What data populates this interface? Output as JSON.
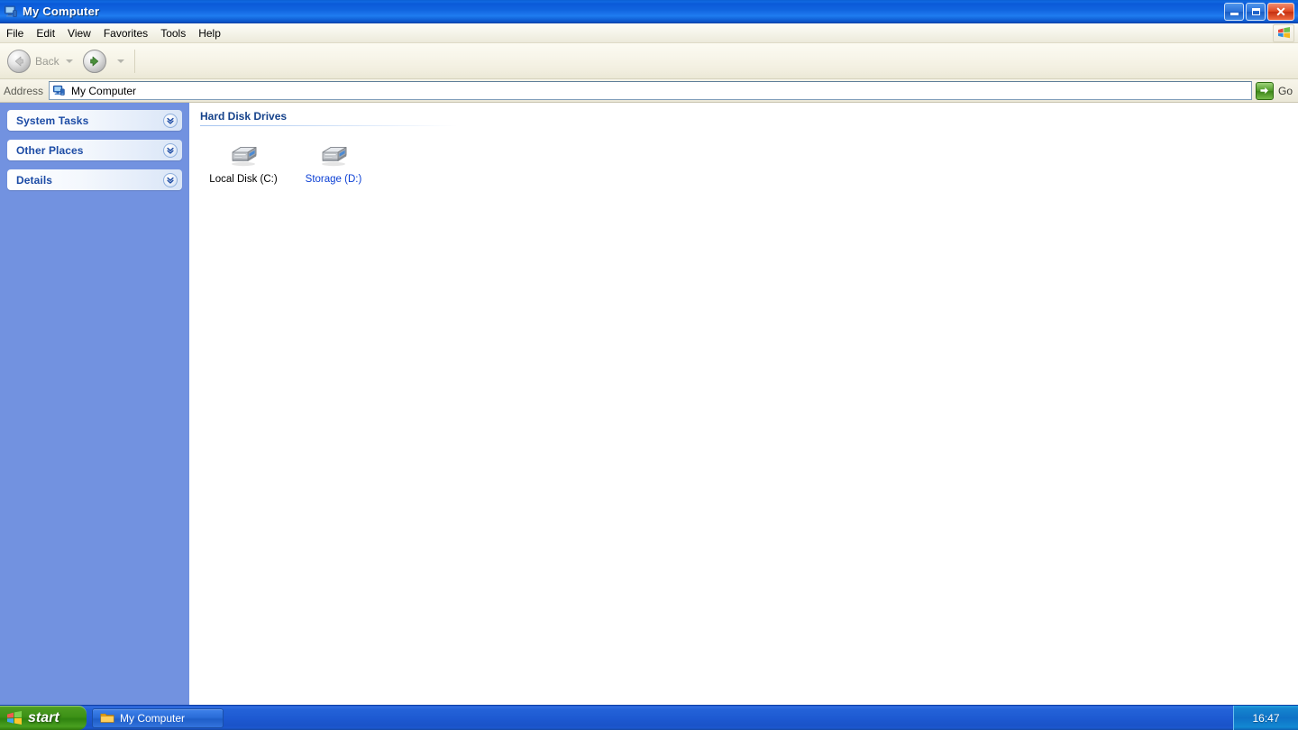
{
  "window": {
    "title": "My Computer",
    "icon": "my-computer-icon",
    "controls": {
      "minimize": "Minimize",
      "restore": "Restore",
      "close": "Close"
    }
  },
  "menubar": {
    "items": [
      {
        "label": "File"
      },
      {
        "label": "Edit"
      },
      {
        "label": "View"
      },
      {
        "label": "Favorites"
      },
      {
        "label": "Tools"
      },
      {
        "label": "Help"
      }
    ],
    "badge_icon": "windows-flag-icon"
  },
  "toolbar": {
    "back_label": "Back",
    "back_enabled": false,
    "forward_label": "",
    "forward_enabled": true,
    "back_icon": "back-arrow-icon",
    "forward_icon": "forward-arrow-icon"
  },
  "address": {
    "label": "Address",
    "value": "My Computer",
    "placeholder": "My Computer",
    "icon": "my-computer-icon",
    "go_label": "Go",
    "go_icon": "green-arrow-icon"
  },
  "sidebar": {
    "panes": [
      {
        "title": "System Tasks",
        "chevron_icon": "chevron-double-down-icon",
        "collapsed": true
      },
      {
        "title": "Other Places",
        "chevron_icon": "chevron-double-down-icon",
        "collapsed": true
      },
      {
        "title": "Details",
        "chevron_icon": "chevron-double-down-icon",
        "collapsed": true
      }
    ]
  },
  "content": {
    "group_title": "Hard Disk Drives",
    "drives": [
      {
        "label": "Local Disk (C:)",
        "icon": "hard-drive-icon",
        "highlighted": false
      },
      {
        "label": "Storage (D:)",
        "icon": "hard-drive-icon",
        "highlighted": true
      }
    ]
  },
  "taskbar": {
    "start_label": "start",
    "start_icon": "windows-flag-icon",
    "buttons": [
      {
        "label": "My Computer",
        "icon": "folder-icon"
      }
    ],
    "clock": "16:47"
  },
  "colors": {
    "titlebar_blue": "#1265e0",
    "sidebar_blue": "#7292e0",
    "pane_title": "#1c4ba5",
    "group_title": "#15428b",
    "highlight_link": "#0b3fd4",
    "start_green": "#3d9116",
    "taskbar_blue": "#1e5ad2",
    "tray_blue": "#0f72c6",
    "close_red": "#c52f10",
    "go_green": "#3b8517"
  }
}
